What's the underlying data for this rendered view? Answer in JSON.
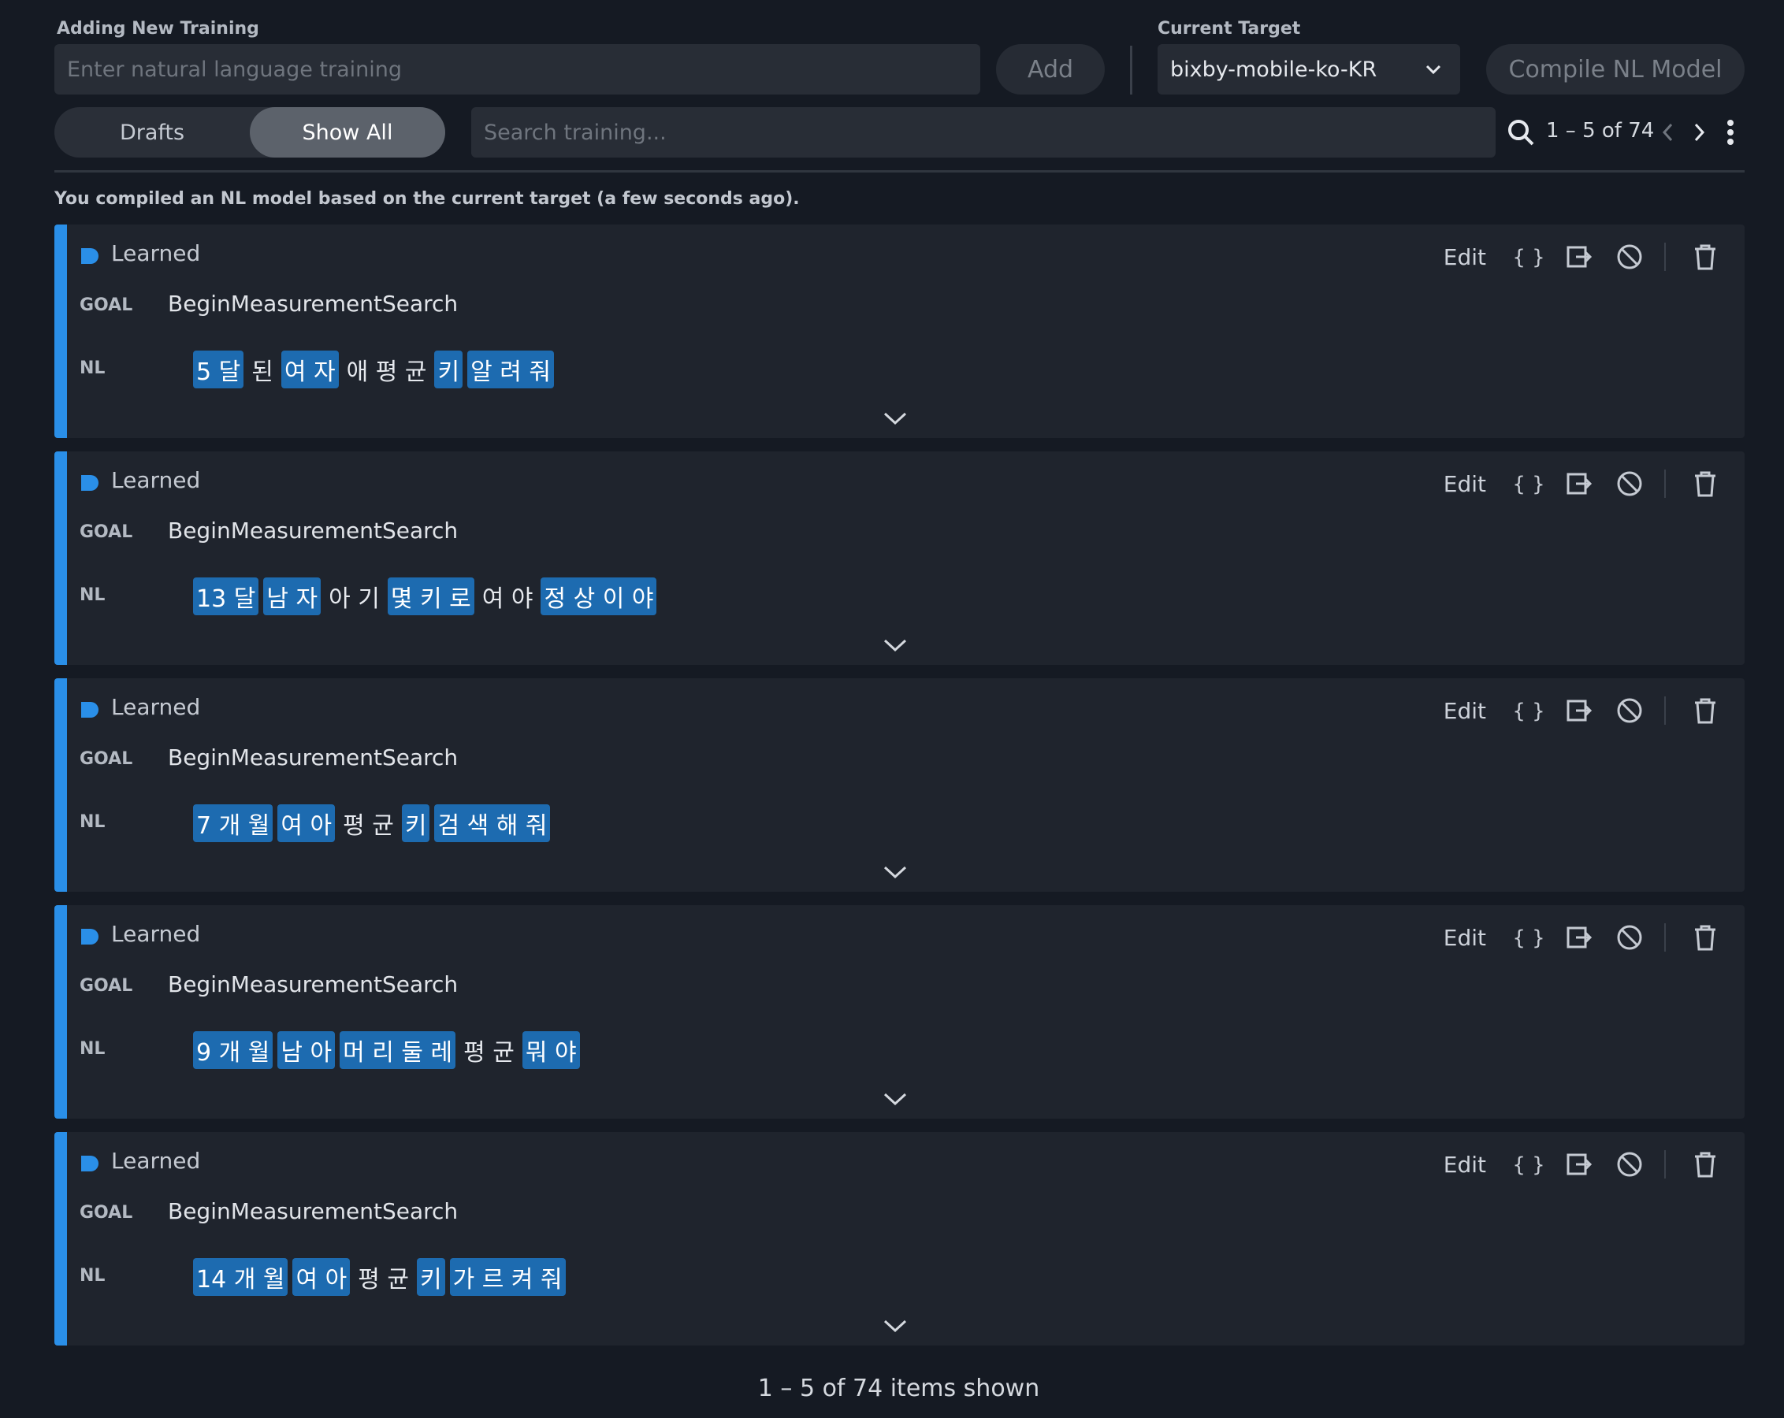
{
  "header": {
    "new_training_label": "Adding New Training",
    "new_training_placeholder": "Enter natural language training",
    "add_label": "Add",
    "current_target_label": "Current Target",
    "current_target_value": "bixby-mobile-ko-KR",
    "compile_label": "Compile NL Model"
  },
  "toolbar": {
    "tabs": [
      {
        "label": "Drafts",
        "active": false
      },
      {
        "label": "Show All",
        "active": true
      }
    ],
    "search_placeholder": "Search training...",
    "pagination": "1 – 5 of 74"
  },
  "notice": "You compiled an NL model based on the current target (a few seconds ago).",
  "cards": [
    {
      "status": "Learned",
      "goal_key": "GOAL",
      "goal": "BeginMeasurementSearch",
      "nl_key": "NL",
      "edit": "Edit",
      "tokens": [
        {
          "text": "5 달",
          "hl": true
        },
        {
          "text": "된",
          "hl": false
        },
        {
          "text": "여 자",
          "hl": true
        },
        {
          "text": "애  평 균",
          "hl": false
        },
        {
          "text": "키",
          "hl": true
        },
        {
          "text": "알 려 줘",
          "hl": true
        }
      ]
    },
    {
      "status": "Learned",
      "goal_key": "GOAL",
      "goal": "BeginMeasurementSearch",
      "nl_key": "NL",
      "edit": "Edit",
      "tokens": [
        {
          "text": "13 달",
          "hl": true
        },
        {
          "text": "남 자",
          "hl": true
        },
        {
          "text": "아 기",
          "hl": false
        },
        {
          "text": "몇 키 로",
          "hl": true
        },
        {
          "text": "여 야",
          "hl": false
        },
        {
          "text": "정 상 이 야",
          "hl": true
        }
      ]
    },
    {
      "status": "Learned",
      "goal_key": "GOAL",
      "goal": "BeginMeasurementSearch",
      "nl_key": "NL",
      "edit": "Edit",
      "tokens": [
        {
          "text": "7 개 월",
          "hl": true
        },
        {
          "text": "여 아",
          "hl": true
        },
        {
          "text": "평 균",
          "hl": false
        },
        {
          "text": "키",
          "hl": true
        },
        {
          "text": "검 색 해 줘",
          "hl": true
        }
      ]
    },
    {
      "status": "Learned",
      "goal_key": "GOAL",
      "goal": "BeginMeasurementSearch",
      "nl_key": "NL",
      "edit": "Edit",
      "tokens": [
        {
          "text": "9 개 월",
          "hl": true
        },
        {
          "text": "남 아",
          "hl": true
        },
        {
          "text": "머 리 둘 레",
          "hl": true
        },
        {
          "text": "평 균",
          "hl": false
        },
        {
          "text": "뭐 야",
          "hl": true
        }
      ]
    },
    {
      "status": "Learned",
      "goal_key": "GOAL",
      "goal": "BeginMeasurementSearch",
      "nl_key": "NL",
      "edit": "Edit",
      "tokens": [
        {
          "text": "14 개 월",
          "hl": true
        },
        {
          "text": "여 아",
          "hl": true
        },
        {
          "text": "평 균",
          "hl": false
        },
        {
          "text": "키",
          "hl": true
        },
        {
          "text": "가 르 켜 줘",
          "hl": true
        }
      ]
    }
  ],
  "footer": "1 – 5 of 74 items shown",
  "colors": {
    "background": "#151a23",
    "card": "#1f242d",
    "accent": "#2a8fe8",
    "highlight": "#1d6bb0"
  },
  "icons": [
    "search-icon",
    "chevron-left-icon",
    "chevron-right-icon",
    "more-vertical-icon",
    "chevron-down-icon",
    "learned-status-icon",
    "json-braces-icon",
    "export-icon",
    "disable-icon",
    "trash-icon"
  ]
}
